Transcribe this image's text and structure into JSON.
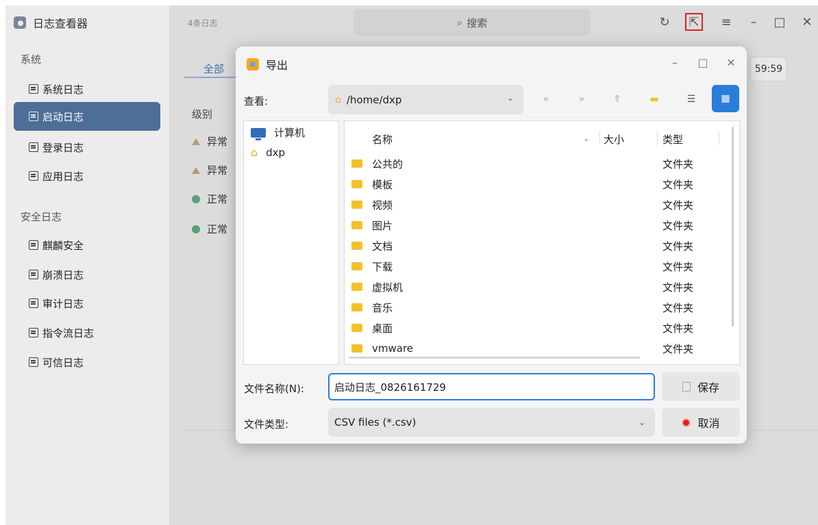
{
  "app": {
    "title": "日志查看器",
    "log_count": "4条日志",
    "search_placeholder": "搜索"
  },
  "sidebar": {
    "section_system": "系统",
    "section_security": "安全日志",
    "items": [
      {
        "label": "系统日志",
        "active": false
      },
      {
        "label": "启动日志",
        "active": true
      },
      {
        "label": "登录日志",
        "active": false
      },
      {
        "label": "应用日志",
        "active": false
      },
      {
        "label": "麒麟安全",
        "active": false
      },
      {
        "label": "崩溃日志",
        "active": false
      },
      {
        "label": "审计日志",
        "active": false
      },
      {
        "label": "指令流日志",
        "active": false
      },
      {
        "label": "可信日志",
        "active": false
      }
    ]
  },
  "main": {
    "tab_all": "全部",
    "time_text": "59:59",
    "column_level": "级别",
    "rows": [
      {
        "level": "异常",
        "status": "warning"
      },
      {
        "level": "异常",
        "status": "warning"
      },
      {
        "level": "正常",
        "status": "ok"
      },
      {
        "level": "正常",
        "status": "ok"
      }
    ]
  },
  "dialog": {
    "title": "导出",
    "look_in_label": "查看:",
    "path": "/home/dxp",
    "places": [
      {
        "label": "计算机",
        "icon": "computer-icon"
      },
      {
        "label": "dxp",
        "icon": "home-icon"
      }
    ],
    "headers": {
      "name": "名称",
      "size": "大小",
      "type": "类型"
    },
    "files": [
      {
        "name": "公共的",
        "type": "文件夹"
      },
      {
        "name": "模板",
        "type": "文件夹"
      },
      {
        "name": "视频",
        "type": "文件夹"
      },
      {
        "name": "图片",
        "type": "文件夹"
      },
      {
        "name": "文档",
        "type": "文件夹"
      },
      {
        "name": "下载",
        "type": "文件夹"
      },
      {
        "name": "虚拟机",
        "type": "文件夹"
      },
      {
        "name": "音乐",
        "type": "文件夹"
      },
      {
        "name": "桌面",
        "type": "文件夹"
      },
      {
        "name": "vmware",
        "type": "文件夹"
      }
    ],
    "filename_label": "文件名称(N):",
    "filename_value": "启动日志_0826161729",
    "filetype_label": "文件类型:",
    "filetype_value": "CSV files (*.csv)",
    "save_label": "保存",
    "cancel_label": "取消"
  },
  "colors": {
    "accent": "#2a7ddb",
    "sidebar_active": "#4d6e96",
    "folder": "#f5c02a",
    "cancel": "#e02020",
    "export_highlight": "#e02020"
  }
}
